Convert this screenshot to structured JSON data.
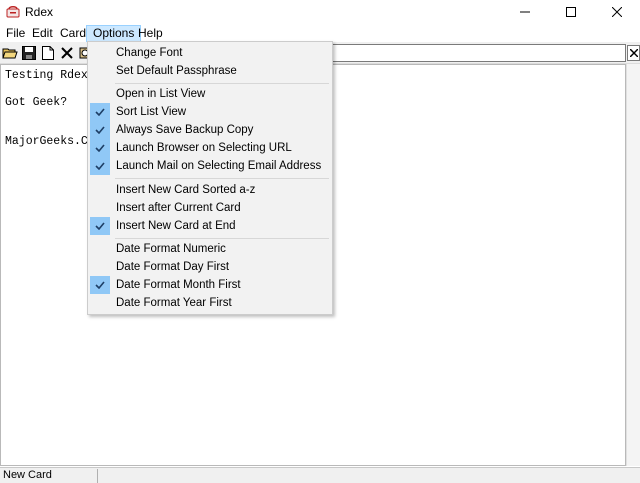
{
  "window": {
    "title": "Rdex"
  },
  "menubar": {
    "file": "File",
    "edit": "Edit",
    "card": "Card",
    "options": "Options",
    "help": "Help"
  },
  "editor": {
    "lines": [
      "Testing Rdex",
      "Got Geek?",
      "MajorGeeks.Co"
    ]
  },
  "status": {
    "text": "New Card"
  },
  "options_menu": {
    "items": [
      {
        "label": "Change Font",
        "checked": false
      },
      {
        "label": "Set Default Passphrase",
        "checked": false
      },
      {
        "label": "Open in List View",
        "checked": false
      },
      {
        "label": "Sort List View",
        "checked": true
      },
      {
        "label": "Always Save Backup Copy",
        "checked": true
      },
      {
        "label": "Launch Browser on Selecting URL",
        "checked": true
      },
      {
        "label": "Launch Mail on Selecting Email Address",
        "checked": true
      },
      {
        "label": "Insert New Card Sorted a-z",
        "checked": false
      },
      {
        "label": "Insert after Current Card",
        "checked": false
      },
      {
        "label": "Insert New Card at End",
        "checked": true
      },
      {
        "label": "Date Format Numeric",
        "checked": false
      },
      {
        "label": "Date Format Day First",
        "checked": false
      },
      {
        "label": "Date Format Month First",
        "checked": true
      },
      {
        "label": "Date Format Year First",
        "checked": false
      }
    ]
  },
  "colors": {
    "menu_highlight": "#cce8ff",
    "check_bg": "#90c8f6",
    "check_mark": "#1e3f66"
  },
  "icons": {
    "app": "rdex-icon",
    "toolbar": [
      "open-folder-icon",
      "save-icon",
      "new-card-icon",
      "delete-icon",
      "find-icon"
    ],
    "check": "check-icon",
    "clear": "close-icon"
  }
}
